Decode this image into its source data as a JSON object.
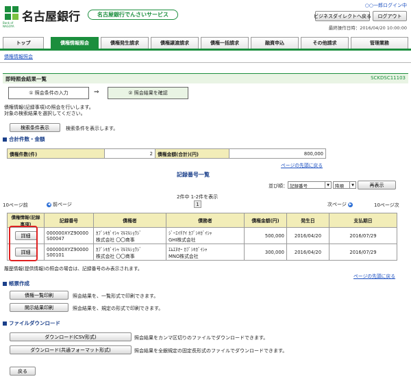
{
  "header": {
    "bank_name": "名古屋銀行",
    "logo_sub": "Bank of NAGOYA",
    "service_name": "名古屋銀行でんさいサービス",
    "user_greeting": "○○一郎ログイン中",
    "direct_back": "ビジネスダイレクトへ戻る",
    "logout": "ログアウト",
    "last_op": "最終操作日時：2016/04/20 10:00:00"
  },
  "tabs": [
    "トップ",
    "債権情報照会",
    "債権発生請求",
    "債権譲渡請求",
    "債権一括請求",
    "融資申込",
    "その他請求",
    "管理業務"
  ],
  "breadcrumb": "債権情報照会",
  "page": {
    "title": "即時照会結果一覧",
    "screen_id": "SCKDSC11103",
    "step1": "① 照会条件の入力",
    "arrow": "⇒",
    "step2": "② 照会結果を確認",
    "desc1": "債権情報(記録事項)の照会を行いします。",
    "desc2": "対象の検索結果を選択してください。",
    "search_btn": "検索条件表示",
    "search_desc": "検索条件を表示します。"
  },
  "totals": {
    "title": "合計件数・金額",
    "count_label": "債権件数(件)",
    "count_value": "2",
    "amount_label": "債権金額(合計)(円)",
    "amount_value": "800,000",
    "top_link": "ページの先頭に戻る"
  },
  "records": {
    "title": "記録番号一覧",
    "sort_label": "並び順：",
    "sort_field": "記録番号",
    "sort_order": "降順",
    "resort_btn": "再表示",
    "count_text": "2件中 1-2件を表示",
    "prev10": "10ページ前",
    "prev": "前ページ",
    "page_num": "1",
    "next": "次ページ",
    "next10": "10ページ次",
    "headers": [
      "債権情報(記録事項)",
      "記録番号",
      "債権者",
      "債務者",
      "債権金額(円)",
      "発生日",
      "支払期日"
    ],
    "rows": [
      {
        "detail": "詳細",
        "record_no": "000000XYZ90000S00047",
        "creditor_kana": "ｶﾌﾞｼｷｶﾞｲｼｬ ﾏﾙﾏﾙｼｮｳｼﾞ",
        "creditor": "株式会社 〇〇商事",
        "debtor_kana": "ｼﾞｰｴｲﾁｱｲ ｶﾌﾞｼｷｶﾞｲｼｬ",
        "debtor": "GHI株式会社",
        "amount": "500,000",
        "issue_date": "2016/04/20",
        "due_date": "2016/07/29"
      },
      {
        "detail": "詳細",
        "record_no": "000000XYZ90000S00101",
        "creditor_kana": "ｶﾌﾞｼｷｶﾞｲｼｬ ﾏﾙﾏﾙｼｮｳｼﾞ",
        "creditor": "株式会社 〇〇商事",
        "debtor_kana": "ｴﾑｴﾇｵｰ ｶﾌﾞｼｷｶﾞｲｼｬ",
        "debtor": "MNO株式会社",
        "amount": "300,000",
        "issue_date": "2016/04/20",
        "due_date": "2016/07/29"
      }
    ],
    "note": "履歴情報(提供情報)の照会の場合は、記録番号のみ表示されます。",
    "top_link": "ページの先頭に戻る"
  },
  "forms": {
    "title": "帳票作成",
    "list_print": "債権一覧印刷",
    "list_print_desc": "照会結果を、一覧形式で印刷できます。",
    "disclose_print": "開示結果印刷",
    "disclose_print_desc": "照会結果を、規定の形式で印刷できます。"
  },
  "download": {
    "title": "ファイルダウンロード",
    "csv": "ダウンロード(CSV形式)",
    "csv_desc": "照会結果をカンマ区切りのファイルでダウンロードできます。",
    "common": "ダウンロード(共通フォーマット形式)",
    "common_desc": "照会結果を全銀規定の固定長形式のファイルでダウンロードできます。"
  },
  "back": "戻る",
  "colors": {
    "brand": "#1b8e3d",
    "title_bar": "#e9f4e4",
    "link": "#1a4ec0",
    "highlight": "#e02020"
  }
}
